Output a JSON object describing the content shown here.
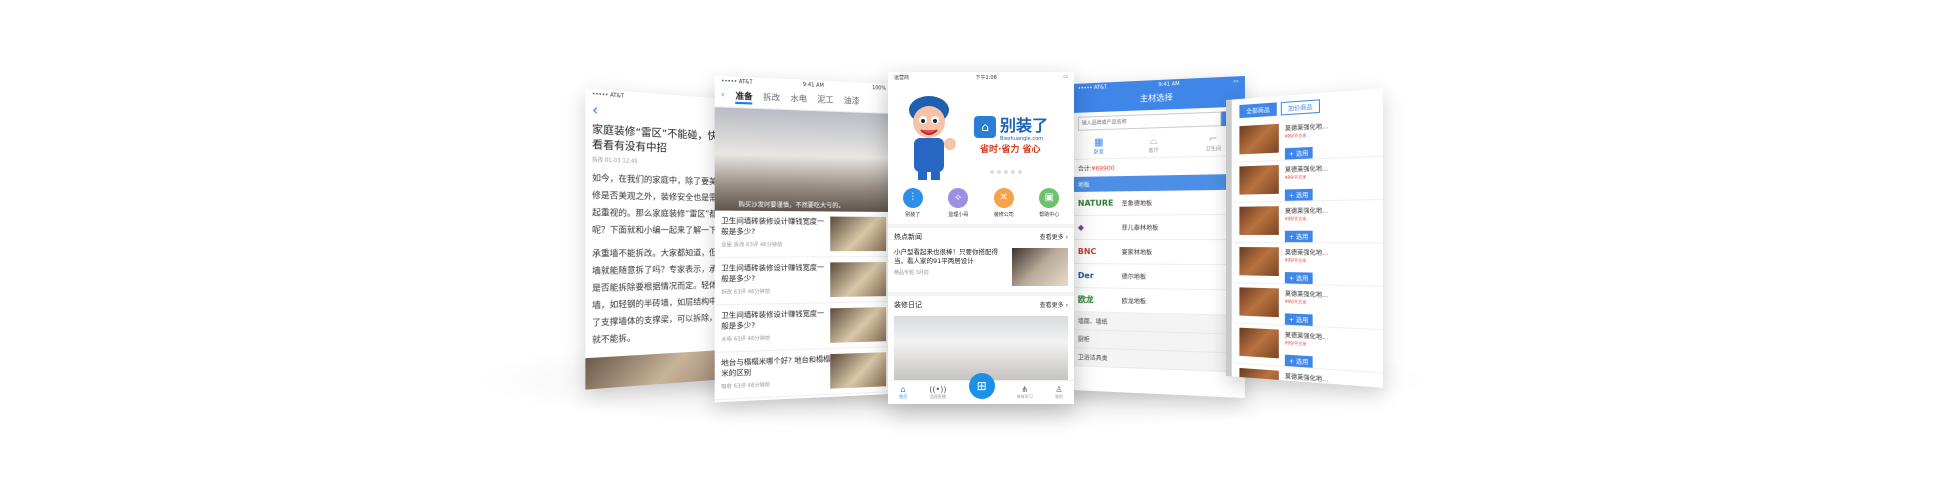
{
  "colors": {
    "accent": "#1677ff",
    "brand_blue": "#3f86e8",
    "price_red": "#e63a2e"
  },
  "phone1": {
    "status_left": "••••• AT&T",
    "back_icon": "back-chevron-icon",
    "title": "家庭装修“雷区”不能碰，快来看看有没有中招",
    "meta": "拆改  01-03 12:45",
    "paragraphs": [
      "如今，在我们的家庭中，除了要美观，修是否美观之外，装修安全也是需要引起重视的。那么家庭装修“雷区”都些呢？下面就和小编一起来了解一下",
      "承重墙不能拆改。大家都知道，但承重墙就能随意拆了吗？专家表示，承重墙是否能拆除要根据情况而定。轻体结构墙，如轻钢的半砖墙，如层结构中设计了支撑墙体的支撑梁，可以拆除，否则就不能拆。"
    ]
  },
  "phone2": {
    "status_left": "••••• AT&T",
    "status_time": "9:41 AM",
    "status_right": "100%",
    "tabs": [
      "准备",
      "拆改",
      "水电",
      "泥工",
      "油漆"
    ],
    "hero_caption": "购买沙发时要谨慎，不然要吃大亏的。",
    "articles": [
      {
        "title": "卫生间墙砖装修设计赚钱宽度一般是多少?",
        "meta": "全屋 拆改  63评  46分钟前"
      },
      {
        "title": "卫生间墙砖装修设计赚钱宽度一般是多少?",
        "meta": "拆改  63评  46分钟前"
      },
      {
        "title": "卫生间墙砖装修设计赚钱宽度一般是多少?",
        "meta": "水电  63评  46分钟前"
      },
      {
        "title": "地台与榻榻米哪个好? 地台和榻榻米的区别",
        "meta": "吸收  63评  46分钟前"
      }
    ]
  },
  "phone3": {
    "status_left": "运营商",
    "status_time": "下午1:08",
    "logo_text": "别装了",
    "logo_url": "Biezhuangle.com",
    "slogan": "省时·省力 省心",
    "icons": [
      {
        "label": "别装了",
        "icon": "equalizer-icon",
        "color": "#2e8fe8"
      },
      {
        "label": "监理小哥",
        "icon": "compass-icon",
        "color": "#9b8fe6"
      },
      {
        "label": "装修公司",
        "icon": "tools-icon",
        "color": "#f5a34a"
      },
      {
        "label": "帮助中心",
        "icon": "help-icon",
        "color": "#6cc26e"
      }
    ],
    "hot_news_title": "热点新闻",
    "hot_more": "查看更多",
    "news_title": "小户型看起来也很棒！只要你搭配得当，看人家的91平两居设计",
    "news_meta": "精品专题  3月前",
    "diary_title": "装修日记",
    "diary_more": "查看更多",
    "nav": [
      {
        "label": "首页",
        "icon": "home-icon"
      },
      {
        "label": "监理直播",
        "icon": "broadcast-icon"
      },
      {
        "label": "",
        "icon": "grid-icon"
      },
      {
        "label": "装修学习",
        "icon": "fork-icon"
      },
      {
        "label": "我的",
        "icon": "user-icon"
      }
    ]
  },
  "phone4": {
    "status_left": "••••• AT&T",
    "status_time": "9:41 AM",
    "title": "主材选择",
    "search_placeholder": "输入品牌或产品名称",
    "rooms": [
      "卧室",
      "客厅",
      "卫生间"
    ],
    "total_label": "合计:",
    "total_value": "¥69900",
    "category": "地板",
    "brands": [
      {
        "logo": "NATURE",
        "name": "圣象德地板"
      },
      {
        "logo": "◆",
        "name": "菲儿泰林地板"
      },
      {
        "logo": "BNC",
        "name": "宴家林地板"
      },
      {
        "logo": "Der",
        "name": "德尔地板"
      },
      {
        "logo": "欧龙",
        "name": "欧龙地板"
      }
    ],
    "grey_items": [
      "墙面、墙纸",
      "厨柜",
      "卫浴洁具类"
    ]
  },
  "phone5": {
    "tabs": [
      "全部商品",
      "加价商品"
    ],
    "product_name": "莫德莱强化地...",
    "price_note": "¥99/平方米",
    "add_label": "+ 选用",
    "count": 7
  }
}
